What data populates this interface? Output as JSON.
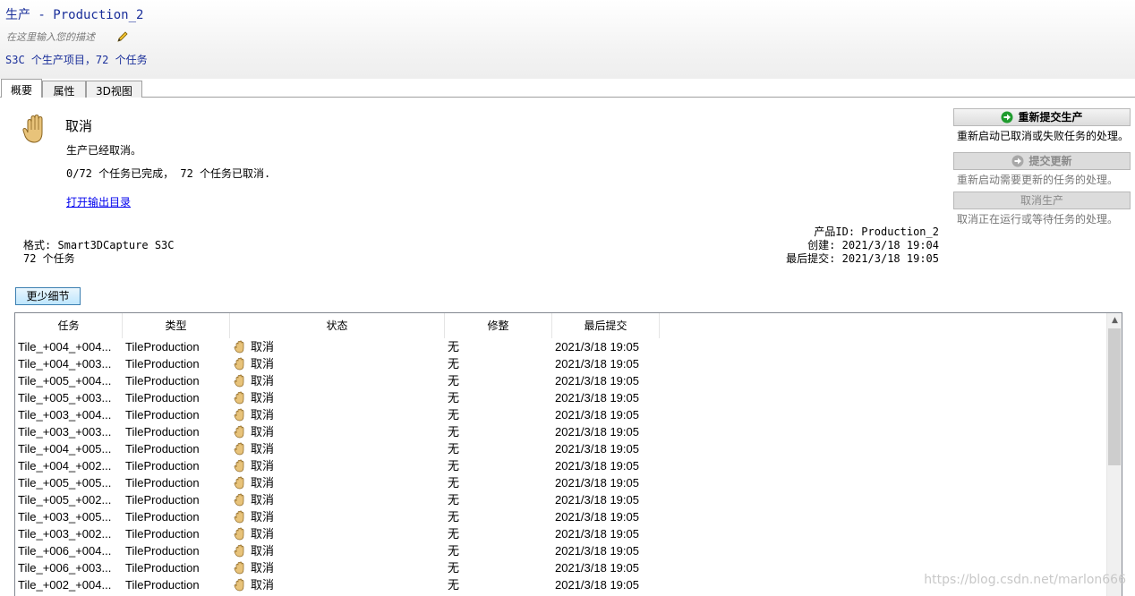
{
  "header": {
    "title": "生产 - Production_2",
    "description_placeholder": "在这里输入您的描述",
    "summary": "S3C 个生产项目，72 个任务"
  },
  "tabs": [
    {
      "label": "概要"
    },
    {
      "label": "属性"
    },
    {
      "label": "3D视图"
    }
  ],
  "status": {
    "title": "取消",
    "line1": "生产已经取消。",
    "line2": "0/72 个任务已完成， 72 个任务已取消.",
    "open_output_link": "打开输出目录"
  },
  "info": {
    "format": "格式: Smart3DCapture S3C",
    "tasks": "72 个任务",
    "product_id": "产品ID: Production_2",
    "created": "创建: 2021/3/18 19:04",
    "last_submit": "最后提交: 2021/3/18 19:05"
  },
  "actions": {
    "resubmit_label": "重新提交生产",
    "resubmit_desc": "重新启动已取消或失败任务的处理。",
    "submit_update_label": "提交更新",
    "submit_update_desc": "重新启动需要更新的任务的处理。",
    "cancel_production_label": "取消生产",
    "cancel_production_desc": "取消正在运行或等待任务的处理。"
  },
  "less_details_label": "更少细节",
  "table": {
    "headers": [
      "任务",
      "类型",
      "状态",
      "修整",
      "最后提交"
    ],
    "rows": [
      {
        "task": "Tile_+004_+004...",
        "type": "TileProduction",
        "state": "取消",
        "fix": "无",
        "date": "2021/3/18 19:05"
      },
      {
        "task": "Tile_+004_+003...",
        "type": "TileProduction",
        "state": "取消",
        "fix": "无",
        "date": "2021/3/18 19:05"
      },
      {
        "task": "Tile_+005_+004...",
        "type": "TileProduction",
        "state": "取消",
        "fix": "无",
        "date": "2021/3/18 19:05"
      },
      {
        "task": "Tile_+005_+003...",
        "type": "TileProduction",
        "state": "取消",
        "fix": "无",
        "date": "2021/3/18 19:05"
      },
      {
        "task": "Tile_+003_+004...",
        "type": "TileProduction",
        "state": "取消",
        "fix": "无",
        "date": "2021/3/18 19:05"
      },
      {
        "task": "Tile_+003_+003...",
        "type": "TileProduction",
        "state": "取消",
        "fix": "无",
        "date": "2021/3/18 19:05"
      },
      {
        "task": "Tile_+004_+005...",
        "type": "TileProduction",
        "state": "取消",
        "fix": "无",
        "date": "2021/3/18 19:05"
      },
      {
        "task": "Tile_+004_+002...",
        "type": "TileProduction",
        "state": "取消",
        "fix": "无",
        "date": "2021/3/18 19:05"
      },
      {
        "task": "Tile_+005_+005...",
        "type": "TileProduction",
        "state": "取消",
        "fix": "无",
        "date": "2021/3/18 19:05"
      },
      {
        "task": "Tile_+005_+002...",
        "type": "TileProduction",
        "state": "取消",
        "fix": "无",
        "date": "2021/3/18 19:05"
      },
      {
        "task": "Tile_+003_+005...",
        "type": "TileProduction",
        "state": "取消",
        "fix": "无",
        "date": "2021/3/18 19:05"
      },
      {
        "task": "Tile_+003_+002...",
        "type": "TileProduction",
        "state": "取消",
        "fix": "无",
        "date": "2021/3/18 19:05"
      },
      {
        "task": "Tile_+006_+004...",
        "type": "TileProduction",
        "state": "取消",
        "fix": "无",
        "date": "2021/3/18 19:05"
      },
      {
        "task": "Tile_+006_+003...",
        "type": "TileProduction",
        "state": "取消",
        "fix": "无",
        "date": "2021/3/18 19:05"
      },
      {
        "task": "Tile_+002_+004...",
        "type": "TileProduction",
        "state": "取消",
        "fix": "无",
        "date": "2021/3/18 19:05"
      }
    ]
  },
  "watermark": "https://blog.csdn.net/marlon666",
  "icons": {
    "hand": "hand-icon",
    "pencil": "pencil-icon",
    "resubmit": "green-arrow-icon",
    "update": "grey-arrow-icon"
  },
  "colors": {
    "title_blue": "#1a2f9a",
    "link_blue": "#0000ee",
    "hand_fill": "#e8c37a",
    "resubmit_green": "#1f9b2e"
  }
}
